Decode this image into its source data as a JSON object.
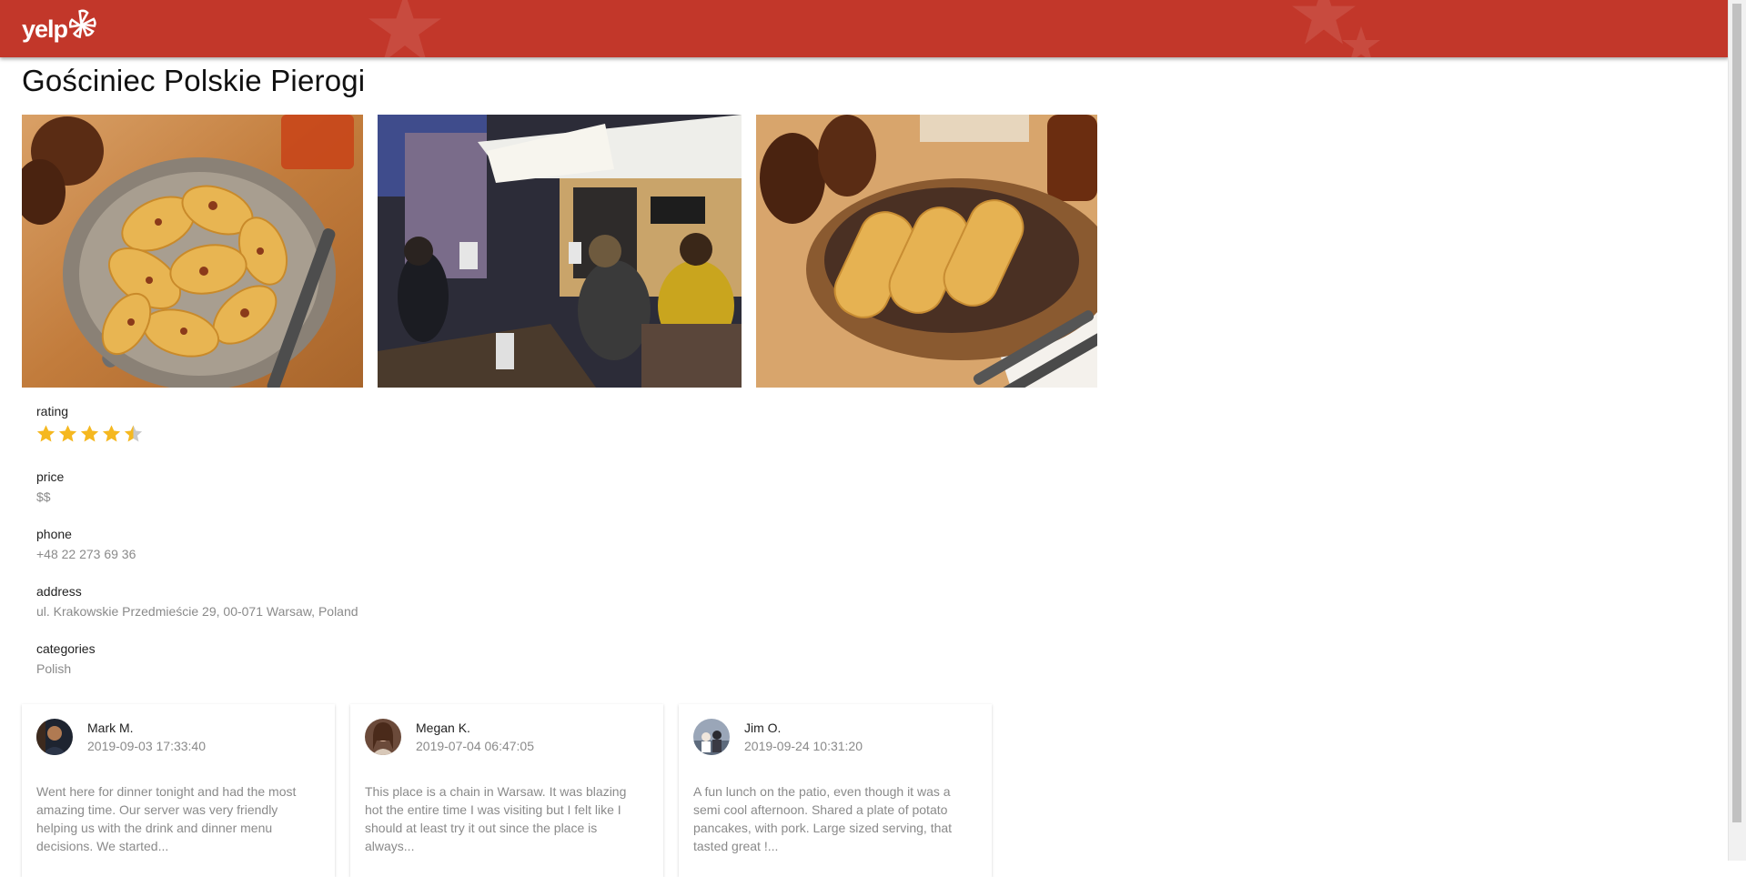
{
  "app": {
    "logo_text": "yelp",
    "logo_icon": "yelp-burst-icon"
  },
  "business": {
    "name": "Gościniec Polskie Pierogi",
    "photos": [
      {
        "icon": "pierogi-pan-photo"
      },
      {
        "icon": "restaurant-patio-photo"
      },
      {
        "icon": "rolled-crepes-photo"
      }
    ],
    "rating": {
      "label": "rating",
      "value": 4.5,
      "max": 5
    },
    "price": {
      "label": "price",
      "value": "$$"
    },
    "phone": {
      "label": "phone",
      "value": "+48 22 273 69 36"
    },
    "address": {
      "label": "address",
      "value": "ul. Krakowskie Przedmieście 29, 00-071 Warsaw, Poland"
    },
    "categories": {
      "label": "categories",
      "value": "Polish"
    }
  },
  "reviews": [
    {
      "name": "Mark M.",
      "time": "2019-09-03 17:33:40",
      "text": "Went here for dinner tonight and had the most amazing time. Our server was very friendly helping us with the drink and dinner menu decisions. We started..."
    },
    {
      "name": "Megan K.",
      "time": "2019-07-04 06:47:05",
      "text": "This place is a chain in Warsaw. It was blazing hot the entire time I was visiting but I felt like I should at least try it out since the place is always..."
    },
    {
      "name": "Jim O.",
      "time": "2019-09-24 10:31:20",
      "text": "A fun lunch on the patio, even though it was a semi cool afternoon. Shared a plate of potato pancakes, with pork. Large sized serving, that tasted great !..."
    }
  ],
  "colors": {
    "header": "#c2372a",
    "star": "#f5b820",
    "star_empty": "#c9c9c9",
    "muted_text": "#8a8a8a"
  }
}
